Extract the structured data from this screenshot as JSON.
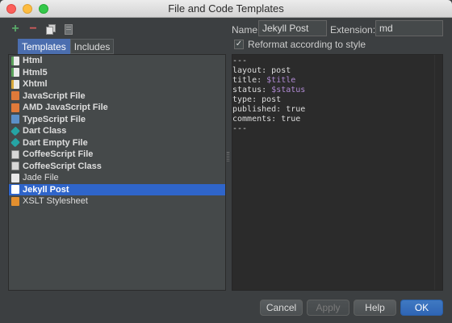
{
  "window": {
    "title": "File and Code Templates"
  },
  "toolbar": {
    "add_icon": "plus-icon",
    "remove_icon": "minus-icon",
    "copy_icon": "copy-icon",
    "reset_icon": "reset-icon",
    "add_glyph": "+",
    "remove_glyph": "−"
  },
  "tabs": [
    {
      "label": "Templates",
      "active": true
    },
    {
      "label": "Includes",
      "active": false
    }
  ],
  "templates": [
    {
      "label": "Html",
      "icon": "html-file-icon",
      "selected": false
    },
    {
      "label": "Html5",
      "icon": "html-file-icon",
      "selected": false
    },
    {
      "label": "Xhtml",
      "icon": "xhtml-file-icon",
      "selected": false
    },
    {
      "label": "JavaScript File",
      "icon": "javascript-file-icon",
      "selected": false
    },
    {
      "label": "AMD JavaScript File",
      "icon": "javascript-file-icon",
      "selected": false
    },
    {
      "label": "TypeScript File",
      "icon": "typescript-file-icon",
      "selected": false
    },
    {
      "label": "Dart Class",
      "icon": "dart-icon",
      "selected": false
    },
    {
      "label": "Dart Empty File",
      "icon": "dart-icon",
      "selected": false
    },
    {
      "label": "CoffeeScript File",
      "icon": "coffeescript-file-icon",
      "selected": false
    },
    {
      "label": "CoffeeScript Class",
      "icon": "coffeescript-file-icon",
      "selected": false
    },
    {
      "label": "Jade File",
      "icon": "jade-file-icon",
      "selected": false
    },
    {
      "label": "Jekyll Post",
      "icon": "jekyll-file-icon",
      "selected": true
    },
    {
      "label": "XSLT Stylesheet",
      "icon": "xslt-file-icon",
      "selected": false
    }
  ],
  "fields": {
    "name_label": "Name:",
    "name_value": "Jekyll Post",
    "extension_label": "Extension:",
    "extension_value": "md",
    "reformat_label": "Reformat according to style",
    "reformat_checked": true
  },
  "editor": {
    "lines": [
      {
        "text": "---",
        "var": ""
      },
      {
        "text": "layout: post",
        "var": ""
      },
      {
        "text": "title: ",
        "var": "$title"
      },
      {
        "text": "status: ",
        "var": "$status"
      },
      {
        "text": "type: post",
        "var": ""
      },
      {
        "text": "published: true",
        "var": ""
      },
      {
        "text": "comments: true",
        "var": ""
      },
      {
        "text": "---",
        "var": ""
      }
    ]
  },
  "buttons": {
    "cancel": "Cancel",
    "apply": "Apply",
    "help": "Help",
    "ok": "OK"
  },
  "colors": {
    "accent": "#2f65ca",
    "primary_button": "#3f79c2",
    "editor_background": "#2b2b2b",
    "template_variable": "#b08ad3"
  }
}
